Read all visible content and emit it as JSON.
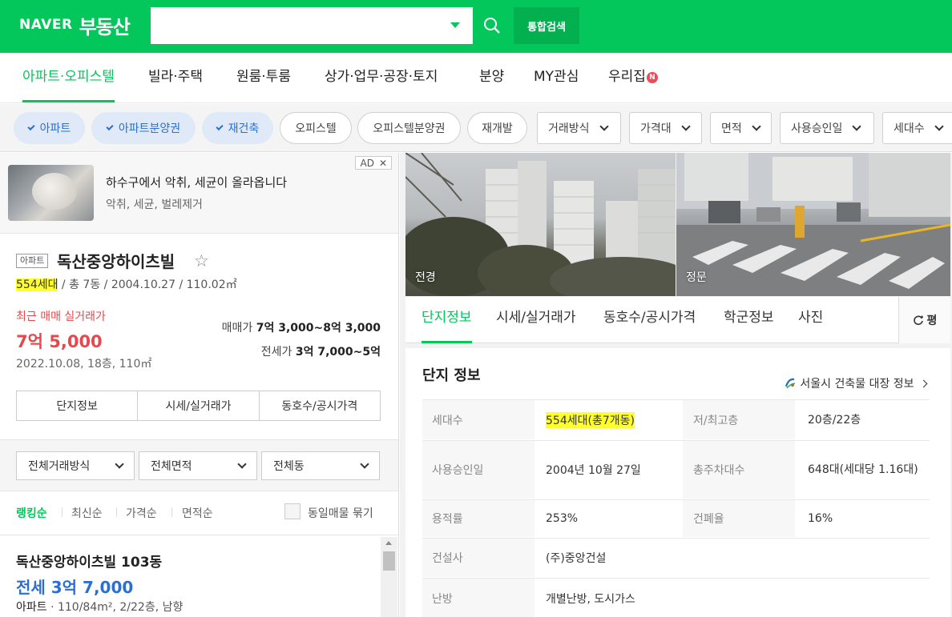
{
  "header": {
    "logo_brand": "NAVER",
    "logo_service": "부동산",
    "search_placeholder": "",
    "total_search_label": "통합검색"
  },
  "nav": {
    "items": [
      "아파트·오피스텔",
      "빌라·주택",
      "원룸·투룸",
      "상가·업무·공장·토지",
      "분양",
      "MY관심",
      "우리집"
    ],
    "badge": "N",
    "active_index": 0
  },
  "filters": {
    "chips_selected": [
      "아파트",
      "아파트분양권",
      "재건축"
    ],
    "chips_unselected": [
      "오피스텔",
      "오피스텔분양권",
      "재개발"
    ],
    "dropdowns": [
      "거래방식",
      "가격대",
      "면적",
      "사용승인일",
      "세대수"
    ]
  },
  "ad": {
    "title": "하수구에서 악취, 세균이 올라옵니다",
    "subtitle": "악취, 세균, 벌레제거",
    "badge": "AD",
    "close": "✕"
  },
  "complex": {
    "type_tag": "아파트",
    "name": "독산중앙하이츠빌",
    "households": "554세대",
    "info_rest": " / 총 7동 / 2004.10.27 / 110.02㎡",
    "recent_label": "최근 매매 실거래가",
    "recent_price": "7억 5,000",
    "recent_date": "2022.10.08, 18층, 110㎡",
    "sale_label": "매매가",
    "sale_value": "7억 3,000~8억 3,000",
    "jeonse_label": "전세가",
    "jeonse_value": "3억 7,000~5억",
    "buttons": [
      "단지정보",
      "시세/실거래가",
      "동호수/공시가격"
    ]
  },
  "list_filters": {
    "dropdowns": [
      "전체거래방식",
      "전체면적",
      "전체동"
    ],
    "sorts": [
      "랭킹순",
      "최신순",
      "가격순",
      "면적순"
    ],
    "same_listing_label": "동일매물 묶기"
  },
  "listing": {
    "name": "독산중앙하이츠빌 103동",
    "price": "전세 3억 7,000",
    "type": "아파트",
    "info": " · 110/84m², 2/22층, 남향"
  },
  "photos": {
    "labels": [
      "전경",
      "정문"
    ]
  },
  "detail_tabs": {
    "items": [
      "단지정보",
      "시세/실거래가",
      "동호수/공시가격",
      "학군정보",
      "사진"
    ],
    "unit_label": "평"
  },
  "info_table": {
    "title": "단지 정보",
    "link": "서울시 건축물 대장 정보",
    "rows": [
      {
        "label": "세대수",
        "value": "554세대(총7개동)",
        "label2": "저/최고층",
        "value2": "20층/22층"
      },
      {
        "label": "사용승인일",
        "value": "2004년 10월 27일",
        "label2": "총주차대수",
        "value2": "648대(세대당 1.16대)"
      },
      {
        "label": "용적률",
        "value": "253%",
        "label2": "건폐율",
        "value2": "16%"
      },
      {
        "label": "건설사",
        "value": "(주)중앙건설",
        "label2": "",
        "value2": ""
      },
      {
        "label": "난방",
        "value": "개별난방, 도시가스",
        "label2": "",
        "value2": ""
      }
    ]
  },
  "colors": {
    "brand_green": "#03c75a",
    "price_red": "#e5484d",
    "price_blue": "#2c6fd1",
    "highlight": "#ffff2e"
  }
}
